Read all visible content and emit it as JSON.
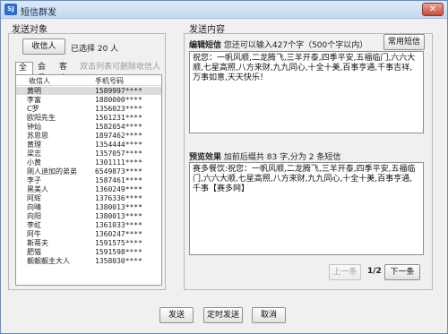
{
  "window": {
    "title": "短信群发",
    "icon_text": "SJ",
    "close_symbol": "✕"
  },
  "left": {
    "section_title": "发送对象",
    "recipient_button": "收信人",
    "selected_count": "已选择 20 人",
    "tabs": [
      "全部",
      "会员",
      "客户"
    ],
    "tab_hint": "双击列表可删除收信人",
    "columns": [
      "收信人",
      "手机号码"
    ],
    "rows": [
      {
        "name": "黄明",
        "phone": "1589997****"
      },
      {
        "name": "李富",
        "phone": "1880000****"
      },
      {
        "name": "C罗",
        "phone": "1356023****"
      },
      {
        "name": "欧阳先生",
        "phone": "1561231****"
      },
      {
        "name": "钟灿",
        "phone": "1582054****"
      },
      {
        "name": "苏思思",
        "phone": "1897462****"
      },
      {
        "name": "黄理",
        "phone": "1354444****"
      },
      {
        "name": "梁志",
        "phone": "1357057****"
      },
      {
        "name": "小黄",
        "phone": "1301111****"
      },
      {
        "name": "刚人迪加的弟弟",
        "phone": "6549873****"
      },
      {
        "name": "李子",
        "phone": "1587461****"
      },
      {
        "name": "黑美人",
        "phone": "1360249****"
      },
      {
        "name": "阿辉",
        "phone": "1376336****"
      },
      {
        "name": "向晴",
        "phone": "1380013****"
      },
      {
        "name": "向阳",
        "phone": "1380013****"
      },
      {
        "name": "李虹",
        "phone": "1361033****"
      },
      {
        "name": "阿牛",
        "phone": "1360247****"
      },
      {
        "name": "斯蒂夫",
        "phone": "1591575****"
      },
      {
        "name": "肥猫",
        "phone": "1591598****"
      },
      {
        "name": "靓靓靓主大人",
        "phone": "1358030****"
      }
    ]
  },
  "right": {
    "section_title": "发送内容",
    "edit_label": "编辑短信",
    "edit_hint": "您还可以输入427个字（500个字以内）",
    "common_sms_button": "常用短信",
    "edit_text": "祝您：一帆风顺,二龙腾飞,三羊开泰,四季平安,五福临门,六六大顺,七星高照,八方来财,九九同心,十全十美,百事亨通,千事吉祥,万事如意,天天快乐！",
    "preview_label": "预览效果",
    "preview_hint": "加前后缀共 83 字,分为 2 条短信",
    "preview_text": "赛多餐饮:祝您：一帆风顺,二龙腾飞,三羊开泰,四季平安,五福临门,六六大顺,七星高照,八方来财,九九同心,十全十美,百事亨通,千事【赛多网】",
    "prev_button": "上一条",
    "page_indicator": "1/2",
    "next_button": "下一条"
  },
  "footer": {
    "send_button": "发送",
    "timed_send_button": "定时发送",
    "cancel_button": "取消"
  }
}
